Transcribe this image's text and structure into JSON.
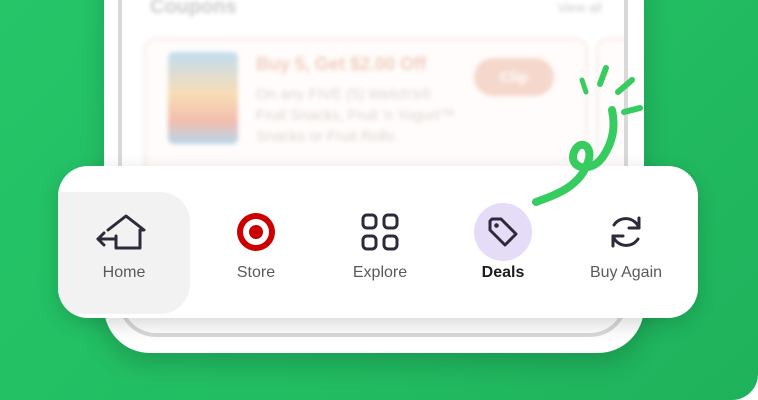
{
  "background": {
    "accent": "#22bd62"
  },
  "content": {
    "coupons_heading": "Coupons",
    "view_all": "View all",
    "coupon": {
      "title": "Buy 5, Get $2.00 Off",
      "description": "On any FIVE (5) Welch's® Fruit Snacks, Fruit 'n Yogurt™ Snacks or Fruit Rolls",
      "clip_label": "Clip"
    }
  },
  "nav": {
    "items": [
      {
        "label": "Home",
        "icon": "home-back-icon",
        "active": false
      },
      {
        "label": "Store",
        "icon": "target-bullseye-icon",
        "active": false
      },
      {
        "label": "Explore",
        "icon": "grid-icon",
        "active": false
      },
      {
        "label": "Deals",
        "icon": "tag-icon",
        "active": true
      },
      {
        "label": "Buy Again",
        "icon": "refresh-icon",
        "active": false
      }
    ],
    "colors": {
      "target_red": "#cc0000",
      "deals_bubble": "#e5dcf8",
      "icon_dark": "#2e2a3a"
    }
  }
}
